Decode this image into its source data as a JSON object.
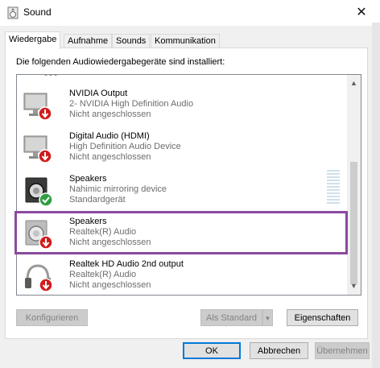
{
  "window": {
    "title": "Sound",
    "close_glyph": "✕"
  },
  "tabs": [
    {
      "label": "Wiedergabe",
      "active": true
    },
    {
      "label": "Aufnahme",
      "active": false
    },
    {
      "label": "Sounds",
      "active": false
    },
    {
      "label": "Kommunikation",
      "active": false
    }
  ],
  "instruction": "Die folgenden Audiowiedergabegeräte sind installiert:",
  "devices": [
    {
      "name": "NVIDIA Output",
      "description": "2- NVIDIA High Definition Audio",
      "status": "Nicht angeschlossen",
      "icon": "monitor-icon",
      "state": "disconnected"
    },
    {
      "name": "Digital Audio (HDMI)",
      "description": "High Definition Audio Device",
      "status": "Nicht angeschlossen",
      "icon": "monitor-icon",
      "state": "disconnected"
    },
    {
      "name": "Speakers",
      "description": "Nahimic mirroring device",
      "status": "Standardgerät",
      "icon": "speaker-icon",
      "state": "default"
    },
    {
      "name": "Speakers",
      "description": "Realtek(R) Audio",
      "status": "Nicht angeschlossen",
      "icon": "speaker-icon",
      "state": "disconnected",
      "highlighted": true
    },
    {
      "name": "Realtek HD Audio 2nd output",
      "description": "Realtek(R) Audio",
      "status": "Nicht angeschlossen",
      "icon": "headphones-icon",
      "state": "disconnected"
    }
  ],
  "buttons": {
    "configure": "Konfigurieren",
    "set_default": "Als Standard",
    "properties": "Eigenschaften",
    "ok": "OK",
    "cancel": "Abbrechen",
    "apply": "Übernehmen"
  },
  "colors": {
    "highlight": "#8a4a9e",
    "disconnected_badge": "#d01c1c",
    "default_badge": "#2f9e44",
    "default_button_border": "#0078d7"
  }
}
